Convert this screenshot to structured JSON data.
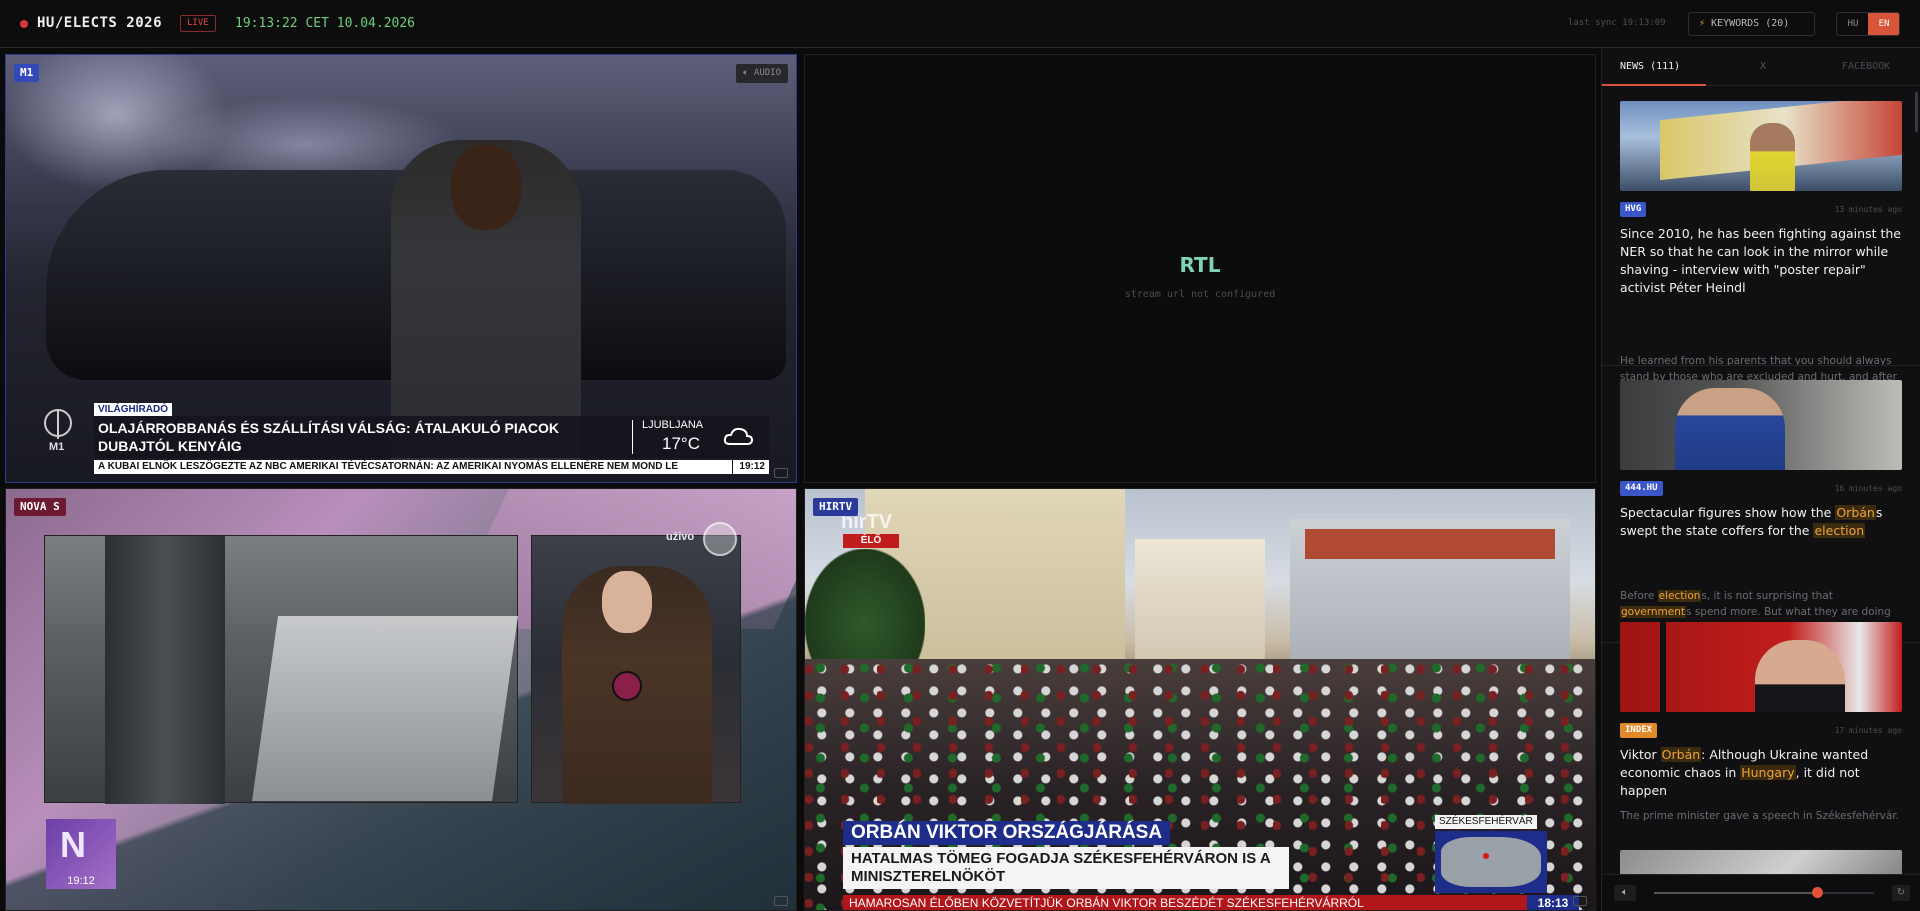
{
  "header": {
    "app_title": "HU/ELECTS 2026",
    "live_badge": "LIVE",
    "clock": "19:13:22 CET 10.04.2026",
    "last_sync": "last sync 19:13:09",
    "keywords_label": "KEYWORDS (20)",
    "lang_hu": "HU",
    "lang_en": "EN",
    "active_lang": "EN",
    "accent_color": "#d9553a"
  },
  "streams": {
    "m1": {
      "tag": "M1",
      "audio_label": "AUDIO",
      "program": "VILÁGHÍRADÓ",
      "headline": "OLAJÁRROBBANÁS ÉS SZÁLLÍTÁSI VÁLSÁG: ÁTALAKULÓ PIACOK DUBAJTÓL KENYÁIG",
      "city": "LJUBLJANA",
      "temp": "17°C",
      "logo_text": "M1",
      "ticker": "A KUBAI ELNÖK LESZÖGEZTE AZ NBC AMERIKAI TÉVÉCSATORNÁN: AZ AMERIKAI NYOMÁS ELLENÉRE NEM MOND LE",
      "ticker_time": "19:12"
    },
    "rtl": {
      "name": "RTL",
      "message": "stream url not configured"
    },
    "nova": {
      "tag": "NOVA S",
      "live_label": "uživo",
      "corner_time": "19:12"
    },
    "hirtv": {
      "tag": "HIRTV",
      "logo_text": "hírTV",
      "live_label": "ÉLŐ",
      "title": "ORBÁN VIKTOR ORSZÁGJÁRÁSA",
      "subtitle": "HATALMAS TÖMEG FOGADJA SZÉKESFEHÉRVÁRON IS A MINISZTERELNÖKÖT",
      "map_label": "SZÉKESFEHÉRVÁR",
      "ticker": "HAMAROSAN ÉLŐBEN KÖZVETÍTJÜK ORBÁN VIKTOR BESZÉDÉT SZÉKESFEHÉRVÁRRÓL",
      "ticker_time": "18:13"
    }
  },
  "sidebar": {
    "tabs": [
      "NEWS (111)",
      "X",
      "FACEBOOK"
    ],
    "active_tab": "NEWS (111)",
    "news": [
      {
        "source": "HVG",
        "source_color": "#3a56c8",
        "time": "13 minutes ago",
        "title": "Since 2010, he has been fighting against the NER so that he can look in the mirror while shaving - interview with \"poster repair\" activist Péter Heindl",
        "desc": "He learned from his parents that you should always stand by those who are excluded and hurt, and after the regime change, he decided to exclusively deal wit..."
      },
      {
        "source": "444.HU",
        "source_color": "#3a56c8",
        "time": "16 minutes ago",
        "title_parts": [
          "Spectacular figures show how the ",
          "Orbán",
          "s swept the state coffers for the ",
          "election"
        ],
        "desc_parts": [
          "Before ",
          "election",
          "s, it is not surprising that ",
          "government",
          "s spend more. But what they are doing now is unbridled spending money."
        ]
      },
      {
        "source": "INDEX",
        "source_color": "#e08a2a",
        "time": "17 minutes ago",
        "title_parts": [
          "Viktor ",
          "Orbán",
          ": Although Ukraine wanted economic chaos in ",
          "Hungary",
          ", it did not happen"
        ],
        "desc": "The prime minister gave a speech in Székesfehérvár."
      }
    ],
    "volume": 0.74
  }
}
